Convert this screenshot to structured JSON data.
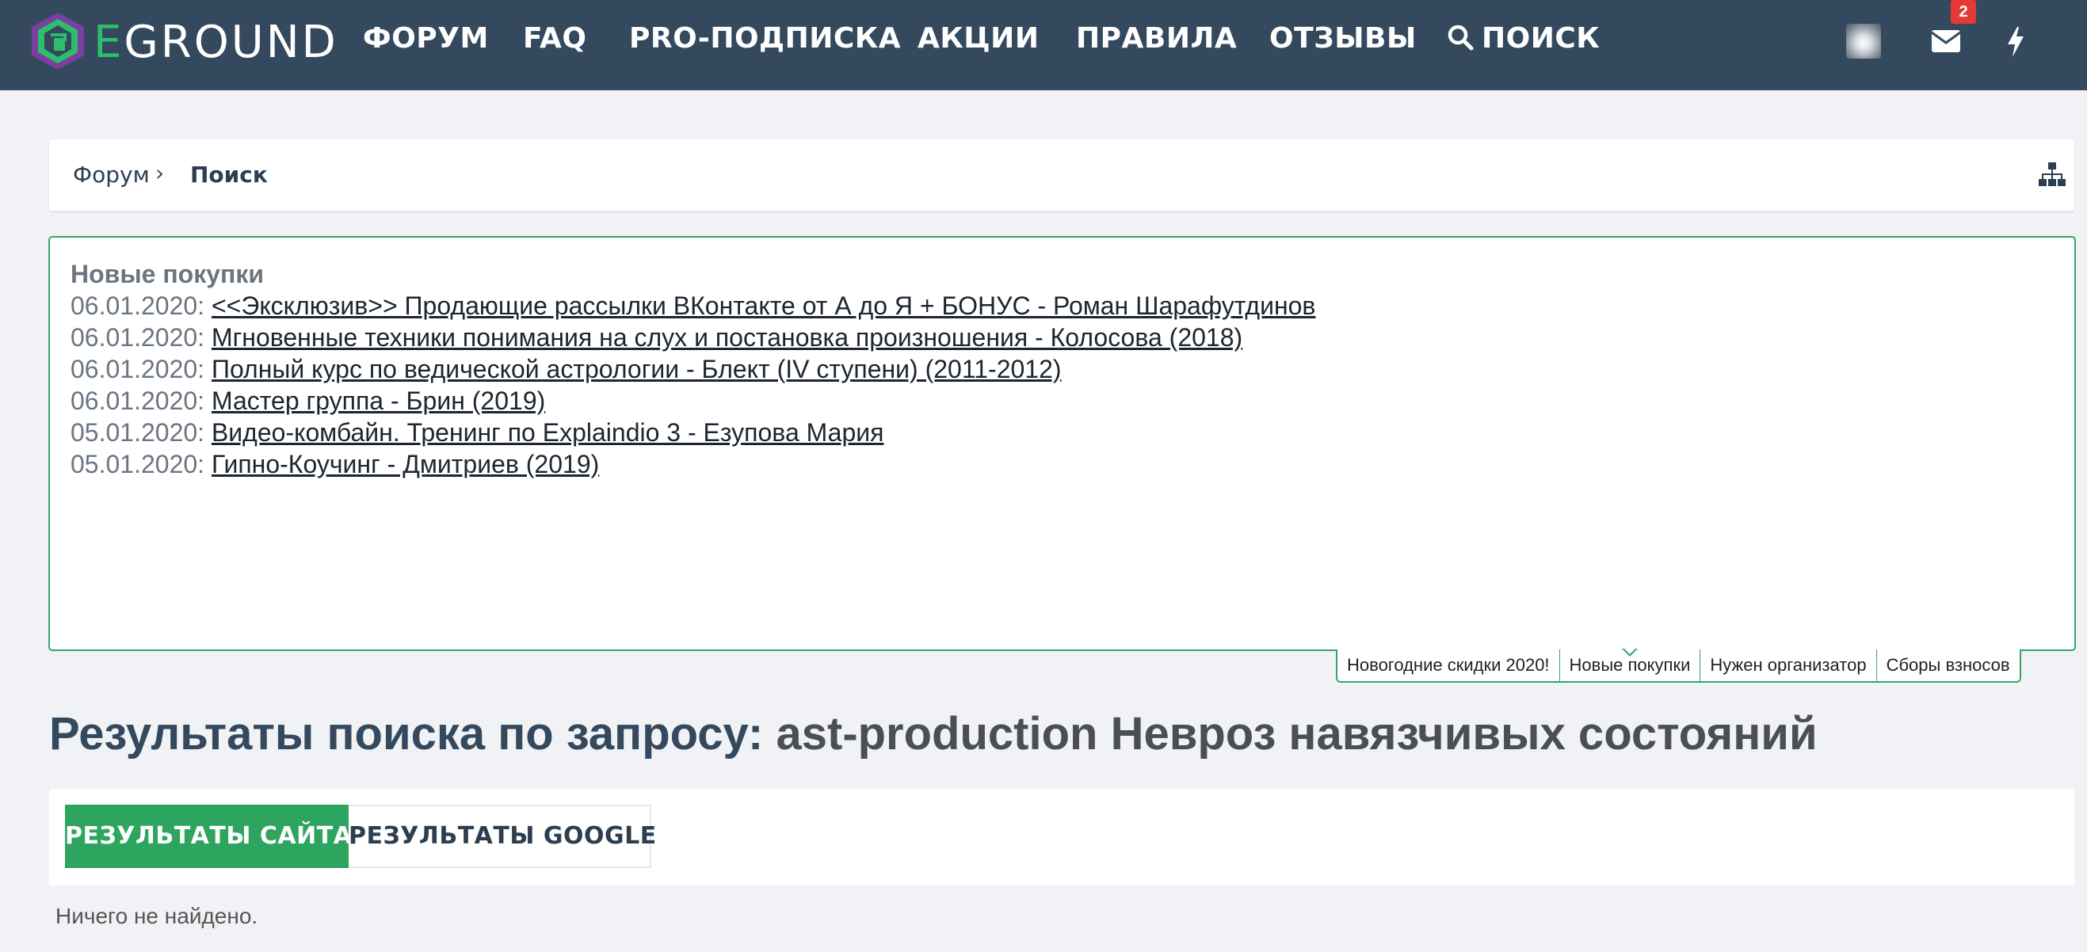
{
  "header": {
    "logo_text_first": "E",
    "logo_text_rest": "GROUND",
    "nav": [
      {
        "label": "ФОРУМ"
      },
      {
        "label": "FAQ"
      },
      {
        "label": "PRO-ПОДПИСКА"
      },
      {
        "label": "АКЦИИ"
      },
      {
        "label": "ПРАВИЛА"
      },
      {
        "label": "ОТЗЫВЫ"
      },
      {
        "label": "ПОИСК",
        "icon": "search-icon"
      }
    ],
    "notifications_count": "2",
    "icons": [
      "avatar",
      "mail-icon",
      "bolt-icon"
    ],
    "colors": {
      "bar": "#34495e",
      "accent": "#2dbe6c",
      "badge": "#e53935"
    }
  },
  "breadcrumb": {
    "items": [
      "Форум",
      "Поиск"
    ],
    "separator": "›"
  },
  "purchases_widget": {
    "title": "Новые покупки",
    "rows": [
      {
        "date": "06.01.2020:",
        "title": "<<Эксклюзив>> Продающие рассылки ВКонтакте от А до Я + БОНУС - Роман Шарафутдинов"
      },
      {
        "date": "06.01.2020:",
        "title": "Мгновенные техники понимания на слух и постановка произношения - Колосова (2018)"
      },
      {
        "date": "06.01.2020:",
        "title": "Полный курс по ведической астрологии - Блект (IV ступени) (2011-2012)"
      },
      {
        "date": "06.01.2020:",
        "title": "Мастер группа - Брин (2019)"
      },
      {
        "date": "05.01.2020:",
        "title": "Видео-комбайн. Тренинг по Explaindio 3 - Езупова Мария"
      },
      {
        "date": "05.01.2020:",
        "title": "Гипно-Коучинг - Дмитриев (2019)"
      }
    ],
    "tabs": [
      "Новогодние скидки 2020!",
      "Новые покупки",
      "Нужен организатор",
      "Сборы взносов"
    ],
    "active_tab": "Новые покупки"
  },
  "search": {
    "heading_prefix": "Результаты поиска по запросу:",
    "query": "ast-production Невроз навязчивых состояний",
    "tabs": {
      "site": "РЕЗУЛЬТАТЫ САЙТА",
      "google": "РЕЗУЛЬТАТЫ GOOGLE"
    },
    "active_tab": "РЕЗУЛЬТАТЫ САЙТА",
    "empty_message": "Ничего не найдено."
  }
}
